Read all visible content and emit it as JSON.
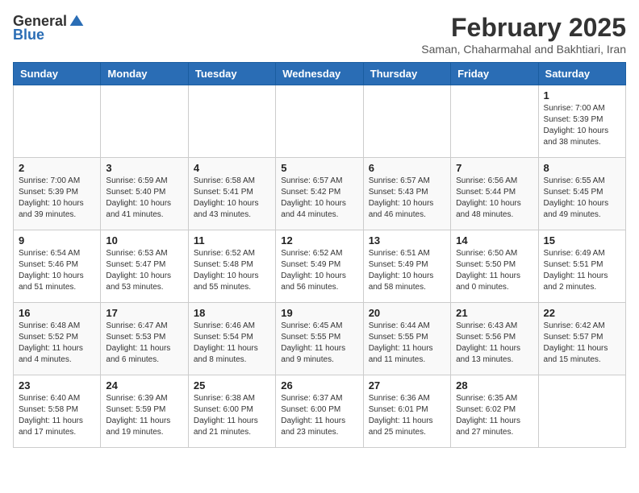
{
  "logo": {
    "general": "General",
    "blue": "Blue"
  },
  "header": {
    "month": "February 2025",
    "location": "Saman, Chaharmahal and Bakhtiari, Iran"
  },
  "weekdays": [
    "Sunday",
    "Monday",
    "Tuesday",
    "Wednesday",
    "Thursday",
    "Friday",
    "Saturday"
  ],
  "weeks": [
    [
      {
        "day": "",
        "info": ""
      },
      {
        "day": "",
        "info": ""
      },
      {
        "day": "",
        "info": ""
      },
      {
        "day": "",
        "info": ""
      },
      {
        "day": "",
        "info": ""
      },
      {
        "day": "",
        "info": ""
      },
      {
        "day": "1",
        "info": "Sunrise: 7:00 AM\nSunset: 5:39 PM\nDaylight: 10 hours\nand 38 minutes."
      }
    ],
    [
      {
        "day": "2",
        "info": "Sunrise: 7:00 AM\nSunset: 5:39 PM\nDaylight: 10 hours\nand 39 minutes."
      },
      {
        "day": "3",
        "info": "Sunrise: 6:59 AM\nSunset: 5:40 PM\nDaylight: 10 hours\nand 41 minutes."
      },
      {
        "day": "4",
        "info": "Sunrise: 6:58 AM\nSunset: 5:41 PM\nDaylight: 10 hours\nand 43 minutes."
      },
      {
        "day": "5",
        "info": "Sunrise: 6:57 AM\nSunset: 5:42 PM\nDaylight: 10 hours\nand 44 minutes."
      },
      {
        "day": "6",
        "info": "Sunrise: 6:57 AM\nSunset: 5:43 PM\nDaylight: 10 hours\nand 46 minutes."
      },
      {
        "day": "7",
        "info": "Sunrise: 6:56 AM\nSunset: 5:44 PM\nDaylight: 10 hours\nand 48 minutes."
      },
      {
        "day": "8",
        "info": "Sunrise: 6:55 AM\nSunset: 5:45 PM\nDaylight: 10 hours\nand 49 minutes."
      }
    ],
    [
      {
        "day": "9",
        "info": "Sunrise: 6:54 AM\nSunset: 5:46 PM\nDaylight: 10 hours\nand 51 minutes."
      },
      {
        "day": "10",
        "info": "Sunrise: 6:53 AM\nSunset: 5:47 PM\nDaylight: 10 hours\nand 53 minutes."
      },
      {
        "day": "11",
        "info": "Sunrise: 6:52 AM\nSunset: 5:48 PM\nDaylight: 10 hours\nand 55 minutes."
      },
      {
        "day": "12",
        "info": "Sunrise: 6:52 AM\nSunset: 5:49 PM\nDaylight: 10 hours\nand 56 minutes."
      },
      {
        "day": "13",
        "info": "Sunrise: 6:51 AM\nSunset: 5:49 PM\nDaylight: 10 hours\nand 58 minutes."
      },
      {
        "day": "14",
        "info": "Sunrise: 6:50 AM\nSunset: 5:50 PM\nDaylight: 11 hours\nand 0 minutes."
      },
      {
        "day": "15",
        "info": "Sunrise: 6:49 AM\nSunset: 5:51 PM\nDaylight: 11 hours\nand 2 minutes."
      }
    ],
    [
      {
        "day": "16",
        "info": "Sunrise: 6:48 AM\nSunset: 5:52 PM\nDaylight: 11 hours\nand 4 minutes."
      },
      {
        "day": "17",
        "info": "Sunrise: 6:47 AM\nSunset: 5:53 PM\nDaylight: 11 hours\nand 6 minutes."
      },
      {
        "day": "18",
        "info": "Sunrise: 6:46 AM\nSunset: 5:54 PM\nDaylight: 11 hours\nand 8 minutes."
      },
      {
        "day": "19",
        "info": "Sunrise: 6:45 AM\nSunset: 5:55 PM\nDaylight: 11 hours\nand 9 minutes."
      },
      {
        "day": "20",
        "info": "Sunrise: 6:44 AM\nSunset: 5:55 PM\nDaylight: 11 hours\nand 11 minutes."
      },
      {
        "day": "21",
        "info": "Sunrise: 6:43 AM\nSunset: 5:56 PM\nDaylight: 11 hours\nand 13 minutes."
      },
      {
        "day": "22",
        "info": "Sunrise: 6:42 AM\nSunset: 5:57 PM\nDaylight: 11 hours\nand 15 minutes."
      }
    ],
    [
      {
        "day": "23",
        "info": "Sunrise: 6:40 AM\nSunset: 5:58 PM\nDaylight: 11 hours\nand 17 minutes."
      },
      {
        "day": "24",
        "info": "Sunrise: 6:39 AM\nSunset: 5:59 PM\nDaylight: 11 hours\nand 19 minutes."
      },
      {
        "day": "25",
        "info": "Sunrise: 6:38 AM\nSunset: 6:00 PM\nDaylight: 11 hours\nand 21 minutes."
      },
      {
        "day": "26",
        "info": "Sunrise: 6:37 AM\nSunset: 6:00 PM\nDaylight: 11 hours\nand 23 minutes."
      },
      {
        "day": "27",
        "info": "Sunrise: 6:36 AM\nSunset: 6:01 PM\nDaylight: 11 hours\nand 25 minutes."
      },
      {
        "day": "28",
        "info": "Sunrise: 6:35 AM\nSunset: 6:02 PM\nDaylight: 11 hours\nand 27 minutes."
      },
      {
        "day": "",
        "info": ""
      }
    ]
  ]
}
